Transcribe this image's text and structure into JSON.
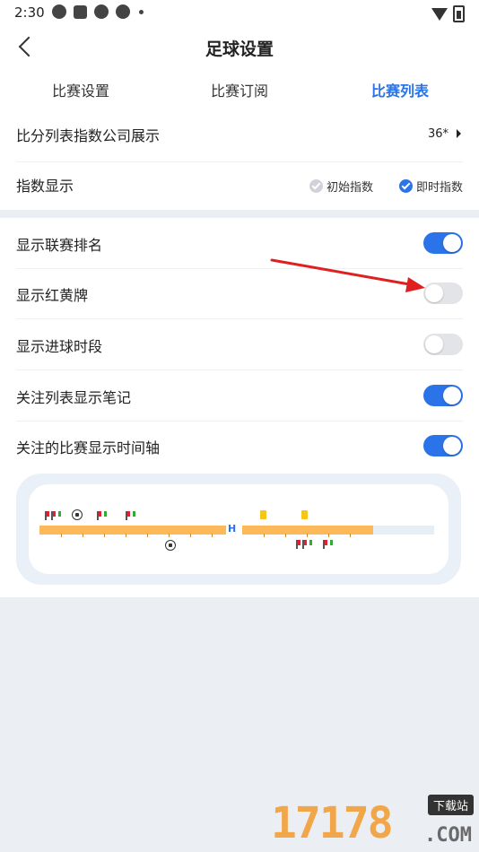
{
  "status_bar": {
    "time": "2:30"
  },
  "header": {
    "title": "足球设置"
  },
  "tabs": [
    {
      "label": "比赛设置",
      "active": false
    },
    {
      "label": "比赛订阅",
      "active": false
    },
    {
      "label": "比赛列表",
      "active": true
    }
  ],
  "section1": {
    "company_row": {
      "label": "比分列表指数公司展示",
      "value": "36*"
    },
    "index_row": {
      "label": "指数显示",
      "options": [
        {
          "label": "初始指数",
          "checked": false
        },
        {
          "label": "即时指数",
          "checked": true
        }
      ]
    }
  },
  "toggles": [
    {
      "label": "显示联赛排名",
      "on": true
    },
    {
      "label": "显示红黄牌",
      "on": false
    },
    {
      "label": "显示进球时段",
      "on": false
    },
    {
      "label": "关注列表显示笔记",
      "on": true
    },
    {
      "label": "关注的比赛显示时间轴",
      "on": true
    }
  ],
  "timeline": {
    "half_marker": "H"
  },
  "watermark": {
    "digits": "17178",
    "label": "下载站",
    "suffix": ".COM"
  },
  "colors": {
    "accent": "#2a73e8",
    "bar": "#fbb95a",
    "arrow": "#e02020"
  }
}
